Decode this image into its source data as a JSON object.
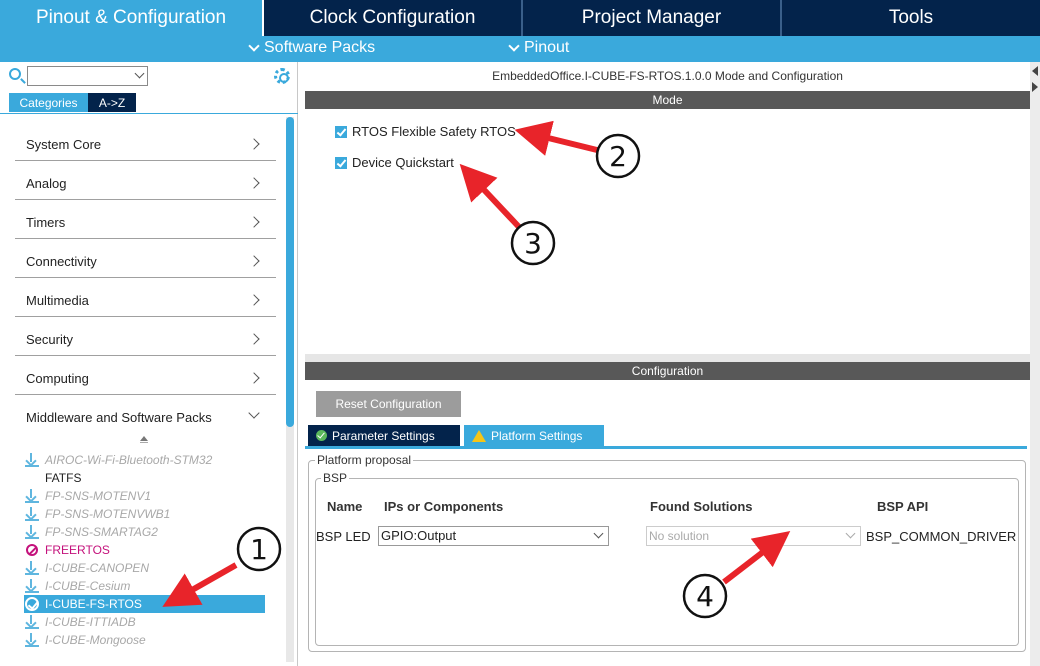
{
  "top_tabs": [
    "Pinout & Configuration",
    "Clock Configuration",
    "Project Manager",
    "Tools"
  ],
  "sub_menu": {
    "software_packs": "Software Packs",
    "pinout": "Pinout"
  },
  "left": {
    "search_placeholder": "",
    "category_tabs": {
      "categories": "Categories",
      "az": "A->Z"
    },
    "categories": [
      "System Core",
      "Analog",
      "Timers",
      "Connectivity",
      "Multimedia",
      "Security",
      "Computing",
      "Middleware and Software Packs"
    ],
    "packs": [
      "AIROC-Wi-Fi-Bluetooth-STM32",
      "FATFS",
      "FP-SNS-MOTENV1",
      "FP-SNS-MOTENVWB1",
      "FP-SNS-SMARTAG2",
      "FREERTOS",
      "I-CUBE-CANOPEN",
      "I-CUBE-Cesium",
      "I-CUBE-FS-RTOS",
      "I-CUBE-ITTIADB",
      "I-CUBE-Mongoose"
    ]
  },
  "right": {
    "title": "EmbeddedOffice.I-CUBE-FS-RTOS.1.0.0 Mode and Configuration",
    "mode_bar": "Mode",
    "mode_options": [
      "RTOS Flexible Safety RTOS",
      "Device Quickstart"
    ],
    "config_bar": "Configuration",
    "reset_button": "Reset Configuration",
    "config_tabs": {
      "parameter": "Parameter Settings",
      "platform": "Platform Settings"
    },
    "platform_legend": "Platform proposal",
    "bsp_legend": "BSP",
    "table": {
      "headers": [
        "Name",
        "IPs or Components",
        "Found Solutions",
        "BSP API"
      ],
      "row": {
        "name": "BSP LED",
        "ip": "GPIO:Output",
        "solution": "No solution",
        "api": "BSP_COMMON_DRIVER"
      }
    }
  },
  "annotations": [
    "1",
    "2",
    "3",
    "4"
  ],
  "colors": {
    "accent": "#3aa9dc",
    "navy": "#03234b",
    "bar_grey": "#585858",
    "arrow_red": "#e8242a",
    "freertos": "#c4127c"
  }
}
